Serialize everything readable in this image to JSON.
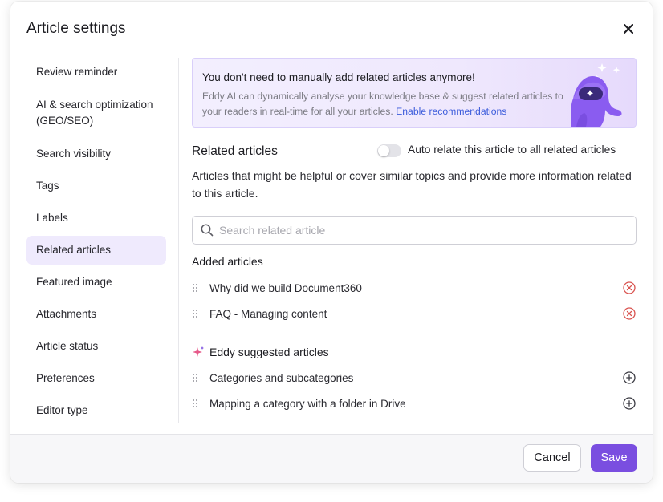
{
  "dialog": {
    "title": "Article settings"
  },
  "sidebar": {
    "items": [
      {
        "label": "Review reminder"
      },
      {
        "label": "AI & search optimization (GEO/SEO)"
      },
      {
        "label": "Search visibility"
      },
      {
        "label": "Tags"
      },
      {
        "label": "Labels"
      },
      {
        "label": "Related articles",
        "active": true
      },
      {
        "label": "Featured image"
      },
      {
        "label": "Attachments"
      },
      {
        "label": "Article status"
      },
      {
        "label": "Preferences"
      },
      {
        "label": "Editor type"
      }
    ]
  },
  "banner": {
    "title": "You don't need to manually add related articles anymore!",
    "text": "Eddy AI can dynamically analyse your knowledge base & suggest related articles to your readers in real-time for all your articles.",
    "link": "Enable recommendations"
  },
  "related": {
    "title": "Related articles",
    "toggle_label": "Auto relate this article to all related articles",
    "toggle_on": false,
    "description": "Articles that might be helpful or cover similar topics and provide more information related to this article.",
    "search_placeholder": "Search related article",
    "added_title": "Added articles",
    "added": [
      {
        "label": "Why did we build Document360"
      },
      {
        "label": "FAQ - Managing content"
      }
    ],
    "suggested_title": "Eddy suggested articles",
    "suggested": [
      {
        "label": "Categories and subcategories"
      },
      {
        "label": "Mapping a category with a folder in Drive"
      }
    ]
  },
  "footer": {
    "cancel_label": "Cancel",
    "save_label": "Save"
  },
  "colors": {
    "accent": "#7a4ee0",
    "active_bg": "#efeafd",
    "remove": "#d9534f",
    "link": "#3b5bdb"
  },
  "icons": {
    "close": "close-icon",
    "search": "search-icon",
    "drag": "drag-handle-icon",
    "remove": "remove-circle-icon",
    "add": "add-circle-icon",
    "sparkle": "sparkle-icon",
    "mascot": "octopus-mascot"
  }
}
